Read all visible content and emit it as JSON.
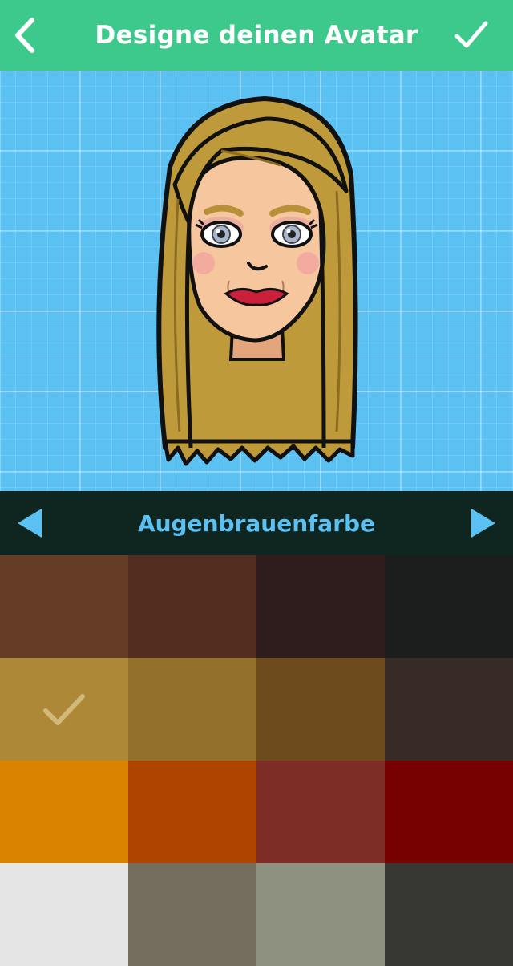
{
  "header": {
    "title": "Designe deinen Avatar",
    "back_icon": "chevron-left-icon",
    "done_icon": "checkmark-icon",
    "background": "#3ec98c"
  },
  "category": {
    "label": "Augenbrauenfarbe",
    "prev_icon": "triangle-left-icon",
    "next_icon": "triangle-right-icon",
    "label_color": "#5bc0f2"
  },
  "swatches": [
    {
      "color": "#653c25",
      "selected": false
    },
    {
      "color": "#542d21",
      "selected": false
    },
    {
      "color": "#2f1d1d",
      "selected": false
    },
    {
      "color": "#1c1e1e",
      "selected": false
    },
    {
      "color": "#ad8937",
      "selected": true
    },
    {
      "color": "#93712b",
      "selected": false
    },
    {
      "color": "#6e4b1d",
      "selected": false
    },
    {
      "color": "#382a27",
      "selected": false
    },
    {
      "color": "#d98300",
      "selected": false
    },
    {
      "color": "#ad4500",
      "selected": false
    },
    {
      "color": "#7e2c26",
      "selected": false
    },
    {
      "color": "#770000",
      "selected": false
    },
    {
      "color": "#e5e5e5",
      "selected": false
    },
    {
      "color": "#756d5e",
      "selected": false
    },
    {
      "color": "#8e9180",
      "selected": false
    },
    {
      "color": "#373833",
      "selected": false
    }
  ]
}
